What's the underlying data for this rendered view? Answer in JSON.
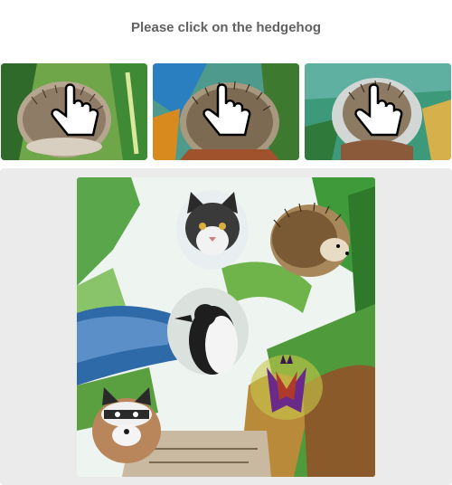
{
  "challenge": {
    "prompt": "Please click on the hedgehog"
  },
  "examples": [
    {
      "subject": "hedgehog",
      "icon": "hand-pointer-icon"
    },
    {
      "subject": "hedgehog",
      "icon": "hand-pointer-icon"
    },
    {
      "subject": "hedgehog",
      "icon": "hand-pointer-icon"
    }
  ],
  "scene": {
    "subjects": [
      "cat",
      "hedgehog",
      "penguin",
      "raccoon",
      "bat"
    ]
  },
  "colors": {
    "prompt_text": "#616161",
    "panel_bg": "#ebebeb"
  }
}
